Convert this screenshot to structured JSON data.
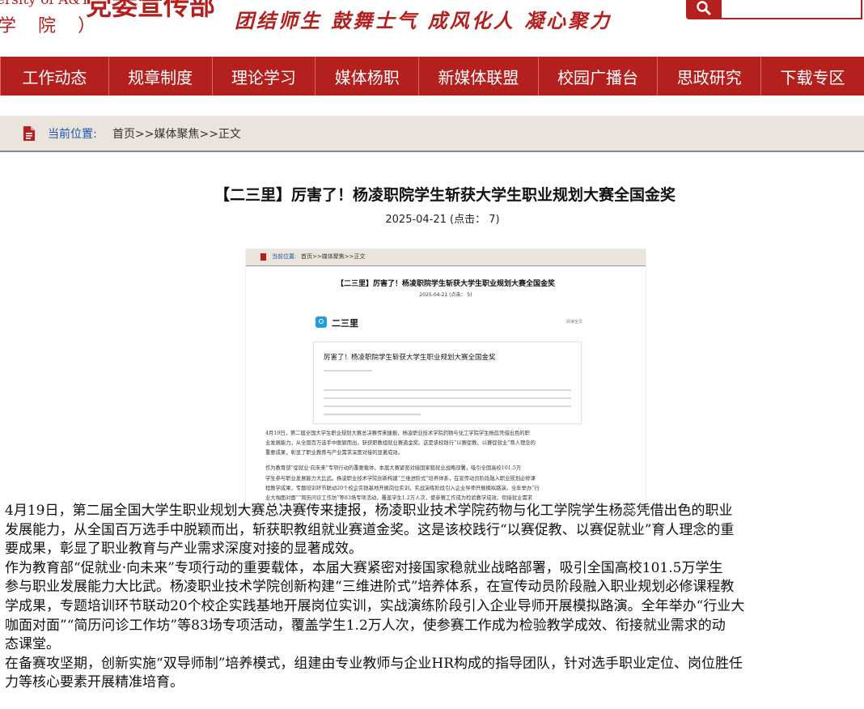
{
  "header": {
    "logo_en": "ersity of A&T",
    "logo_cn": "党委宣传部",
    "logo_sub": "学 院 ）",
    "slogan": "团结师生  鼓舞士气  成风化人  凝心聚力",
    "search_placeholder": ""
  },
  "nav": {
    "items": [
      "工作动态",
      "规章制度",
      "理论学习",
      "媒体杨职",
      "新媒体联盟",
      "校园广播台",
      "思政研究",
      "下载专区"
    ]
  },
  "breadcrumb": {
    "label": "当前位置:",
    "path": "首页>>媒体聚焦>>正文"
  },
  "article": {
    "title": "【二三里】厉害了！杨凌职院学生斩获大学生职业规划大赛全国金奖",
    "meta": "2025-04-21     (点击：  7)",
    "body_lines": [
      "   4月19日，第二届全国大学生职业规划大赛总决赛传来捷报，杨凌职业技术学院药物与化工学院学生杨蕊凭借出色的职业",
      "发展能力，从全国百万选手中脱颖而出，斩获职教组就业赛道金奖。这是该校践行“以赛促教、以赛促就业”育人理念的重",
      "要成果，彰显了职业教育与产业需求深度对接的显著成效。",
      "作为教育部“促就业·向未来”专项行动的重要载体，本届大赛紧密对接国家稳就业战略部署，吸引全国高校101.5万学生",
      "参与职业发展能力大比武。杨凌职业技术学院创新构建“三维进阶式”培养体系，在宣传动员阶段融入职业规划必修课程教",
      "学成果，专题培训环节联动20个校企实践基地开展岗位实训，实战演练阶段引入企业导师开展模拟路演。全年举办“行业大",
      "咖面对面”“简历问诊工作坊”等83场专项活动，覆盖学生1.2万人次，使参赛工作成为检验教学成效、衔接就业需求的动",
      "态课堂。",
      "在备赛攻坚期，创新实施“双导师制”培养模式，组建由专业教师与企业HR构成的指导团队，针对选手职业定位、岗位胜任",
      "力等核心要素开展精准培育。"
    ]
  },
  "embedded_image": {
    "crumb_label": "当前位置:",
    "crumb_path": "首页>>媒体聚焦>>正文",
    "title": "【二三里】厉害了！杨凌职院学生斩获大学生职业规划大赛全国金奖",
    "meta": "2025-04-21     (点击：  5)",
    "account": "二三里",
    "more": "阅读全文",
    "card_title": "厉害了！杨凌职院学生斩获大学生职业规划大赛全国金奖",
    "para_lines": [
      "   4月19日，第二届全国大学生职业规划大赛总决赛传来捷报，杨凌职业技术学院药物与化工学院学生杨蕊凭借出色的职",
      "业发展能力，从全国百万选手中脱颖而出，斩获职教组就业赛道金奖。这是该校践行“以赛促教、以赛促就业”育人理念的",
      "重要成果，彰显了职业教育与产业需求深度对接的显著成效。",
      "   作为教育部“促就业·向未来”专项行动的重要载体，本届大赛紧密对接国家稳就业战略部署，吸引全国高校101.5万",
      "学生参与职业发展能力大比武。杨凌职业技术学院创新构建“三维进阶式”培养体系，在宣传动员阶段融入职业规划必修课",
      "程教学成果，专题培训环节联动20个校企实践基地开展岗位实训，实战演练阶段引入企业导师开展模拟路演。全年举办“行",
      "业大咖面对面”“简历问诊工作坊”等83场专项活动，覆盖学生1.2万人次，使参赛工作成为检验教学成效、衔接就业需求"
    ]
  }
}
